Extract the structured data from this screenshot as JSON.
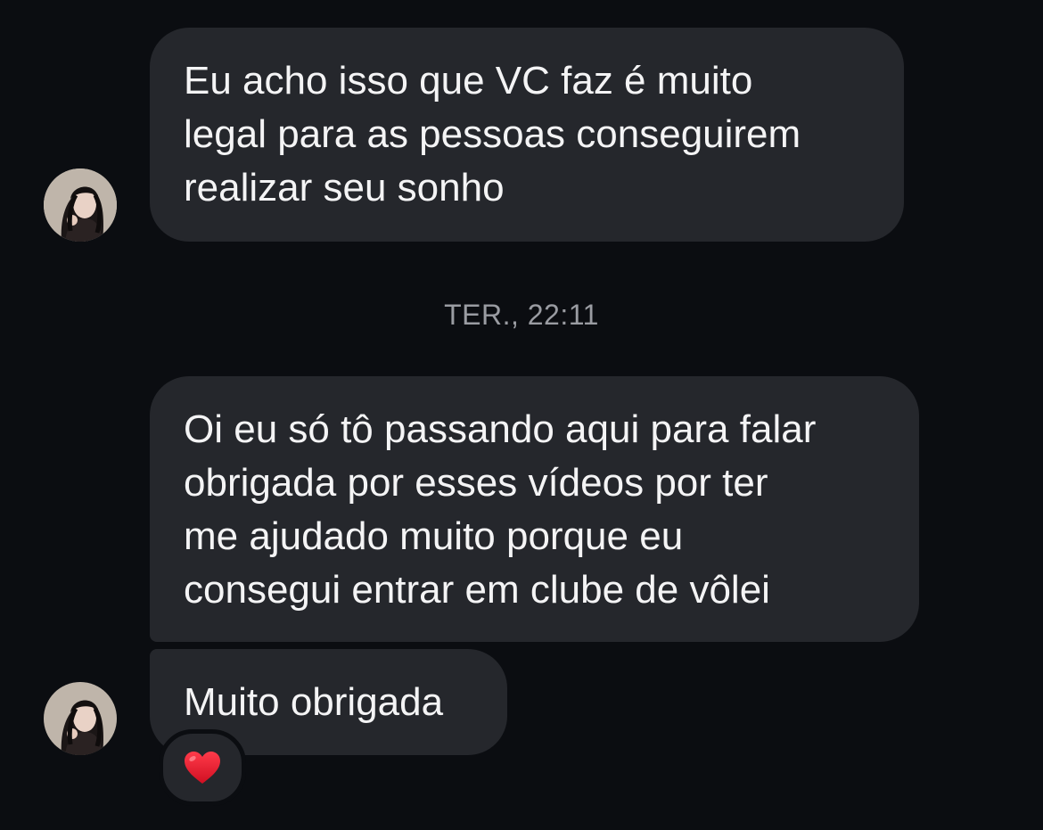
{
  "conversation": {
    "messages": [
      {
        "lines": [
          "Eu acho isso que VC faz é muito",
          "legal para as pessoas conseguirem",
          "realizar seu sonho"
        ]
      },
      {
        "lines": [
          "Oi eu só tô passando aqui para falar",
          "obrigada por esses vídeos por ter",
          "me ajudado muito porque eu",
          "consegui entrar em clube de vôlei"
        ]
      },
      {
        "lines": [
          "Muito obrigada"
        ],
        "reaction": "❤️"
      }
    ],
    "timestamp": "TER., 22:11"
  },
  "colors": {
    "background": "#0b0d11",
    "bubble": "#25272c",
    "text": "#f4f4f5",
    "timestamp": "#9a9ca2",
    "heart": "#e8192c"
  },
  "icons": {
    "avatar": "profile-photo-avatar",
    "reaction": "red-heart-icon"
  }
}
